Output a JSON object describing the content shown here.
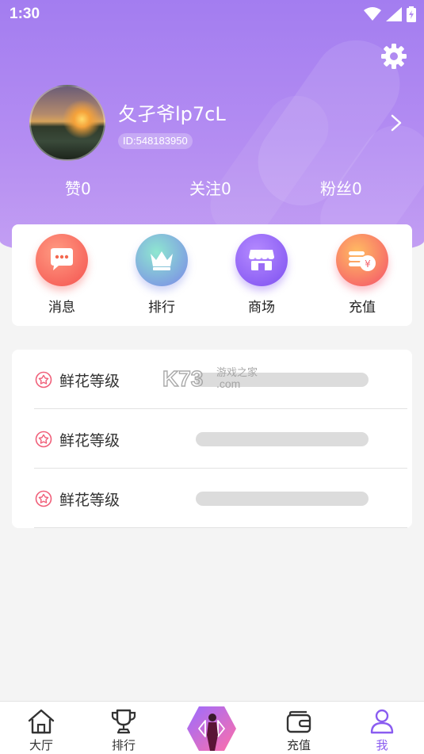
{
  "status_bar": {
    "time": "1:30"
  },
  "profile": {
    "username": "夂孑爷lp7cL",
    "user_id": "ID:548183950"
  },
  "stats": [
    {
      "label": "赞",
      "value": "0"
    },
    {
      "label": "关注",
      "value": "0"
    },
    {
      "label": "粉丝",
      "value": "0"
    }
  ],
  "quick_actions": [
    {
      "label": "消息",
      "icon": "chat-bubble-icon"
    },
    {
      "label": "排行",
      "icon": "crown-icon"
    },
    {
      "label": "商场",
      "icon": "shop-icon"
    },
    {
      "label": "充值",
      "icon": "coins-icon"
    }
  ],
  "level_rows": [
    {
      "label": "鲜花等级",
      "icon": "flower-icon"
    },
    {
      "label": "鲜花等级",
      "icon": "flower-icon"
    },
    {
      "label": "鲜花等级",
      "icon": "flower-icon"
    }
  ],
  "watermark": {
    "text": "K73",
    "sub1": "游戏之家",
    "sub2": ".com"
  },
  "tabbar": [
    {
      "label": "大厅",
      "icon": "home-icon",
      "active": false
    },
    {
      "label": "排行",
      "icon": "trophy-icon",
      "active": false
    },
    {
      "label": "",
      "icon": "center-avatar-icon",
      "active": false
    },
    {
      "label": "充值",
      "icon": "wallet-icon",
      "active": false
    },
    {
      "label": "我",
      "icon": "person-icon",
      "active": true
    }
  ],
  "colors": {
    "header_top": "#a37df0",
    "header_bottom": "#c4a0f3",
    "active_tab": "#8a5cf0",
    "level_icon": "#f0607a"
  }
}
